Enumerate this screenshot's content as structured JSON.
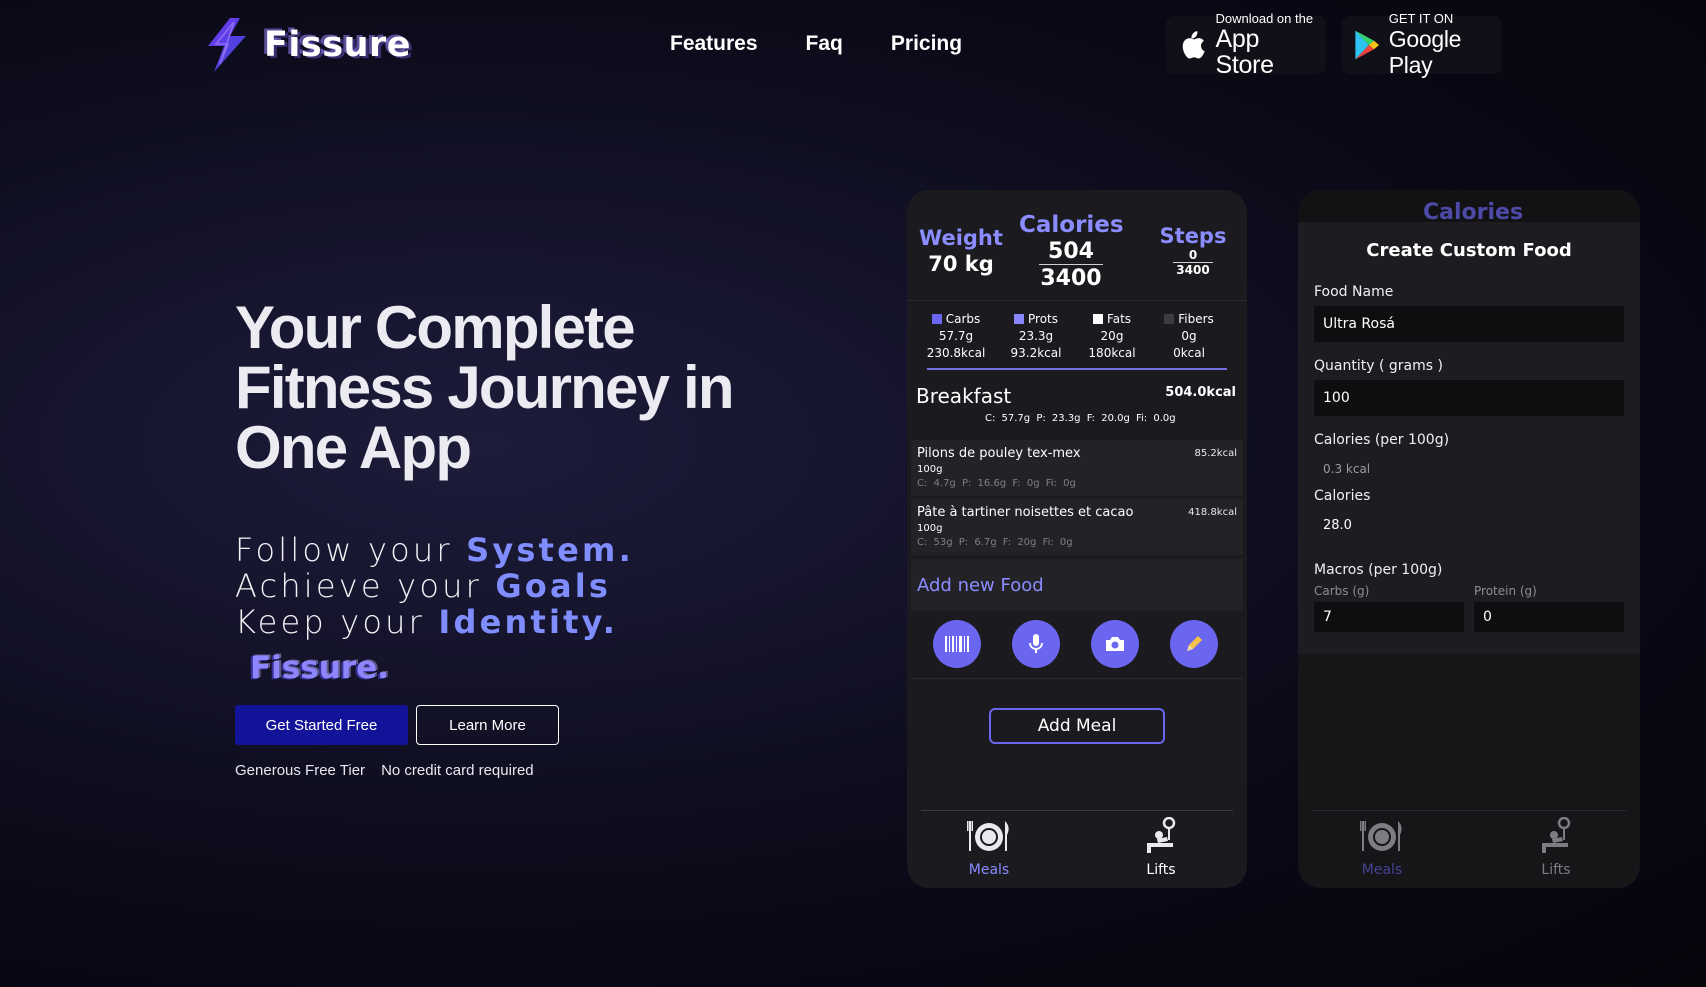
{
  "brand": {
    "name": "Fissure",
    "accent": "#8a8cff",
    "primary": "#13139a"
  },
  "nav": {
    "items": [
      "Features",
      "Faq",
      "Pricing"
    ]
  },
  "stores": {
    "apple": {
      "small": "Download on the",
      "big": "App Store",
      "icon": "apple-icon"
    },
    "google": {
      "small": "GET IT ON",
      "big": "Google Play",
      "icon": "google-play-icon"
    }
  },
  "hero": {
    "title": "Your Complete Fitness Journey in One App",
    "lines": [
      {
        "prefix": "Follow your ",
        "highlight": "System."
      },
      {
        "prefix": "Achieve your ",
        "highlight": "Goals"
      },
      {
        "prefix": "Keep your ",
        "highlight": "Identity."
      }
    ],
    "brand_word": "Fissure.",
    "cta_primary": "Get Started Free",
    "cta_secondary": "Learn More",
    "perks": [
      "Generous Free Tier",
      "No credit card required"
    ]
  },
  "phone1": {
    "weight": {
      "label": "Weight",
      "value": "70 kg"
    },
    "calories": {
      "label": "Calories",
      "current": "504",
      "goal": "3400"
    },
    "steps": {
      "label": "Steps",
      "current": "0",
      "goal": "3400"
    },
    "macros": [
      {
        "label": "Carbs",
        "grams": "57.7g",
        "kcal": "230.8kcal",
        "color": "#6a66ef"
      },
      {
        "label": "Prots",
        "grams": "23.3g",
        "kcal": "93.2kcal",
        "color": "#8a86ff"
      },
      {
        "label": "Fats",
        "grams": "20g",
        "kcal": "180kcal",
        "color": "#ffffff"
      },
      {
        "label": "Fibers",
        "grams": "0g",
        "kcal": "0kcal",
        "color": "#3b3b44"
      }
    ],
    "meal": {
      "title": "Breakfast",
      "kcal": "504.0kcal",
      "macros": "C: 57.7g  P: 23.3g  F: 20.0g  Fi: 0.0g",
      "foods": [
        {
          "name": "Pilons de pouley tex-mex",
          "kcal": "85.2kcal",
          "qty": "100g",
          "macros": "C: 4.7g  P: 16.6g  F: 0g  Fi: 0g"
        },
        {
          "name": "Pâte à tartiner noisettes et cacao",
          "kcal": "418.8kcal",
          "qty": "100g",
          "macros": "C: 53g  P: 6.7g  F: 20g  Fi: 0g"
        }
      ],
      "add_food": "Add new Food"
    },
    "actions": [
      "barcode-icon",
      "microphone-icon",
      "camera-icon",
      "pencil-icon"
    ],
    "add_meal": "Add Meal",
    "tabs": [
      {
        "label": "Meals",
        "icon": "meals-icon",
        "active": true
      },
      {
        "label": "Lifts",
        "icon": "lifts-icon",
        "active": false
      }
    ]
  },
  "phone2": {
    "peek_title": "Calories",
    "modal_title": "Create Custom Food",
    "fields": {
      "food_name_label": "Food Name",
      "food_name_value": "Ultra Rosá",
      "quantity_label": "Quantity ( grams )",
      "quantity_value": "100",
      "cal_per_100_label": "Calories (per 100g)",
      "cal_per_100_value": "0.3 kcal",
      "calories_label": "Calories",
      "calories_value": "28.0",
      "macros_label": "Macros (per 100g)",
      "carbs_label": "Carbs (g)",
      "carbs_value": "7",
      "protein_label": "Protein (g)",
      "protein_value": "0"
    },
    "tabs": [
      {
        "label": "Meals",
        "icon": "meals-icon"
      },
      {
        "label": "Lifts",
        "icon": "lifts-icon"
      }
    ]
  }
}
